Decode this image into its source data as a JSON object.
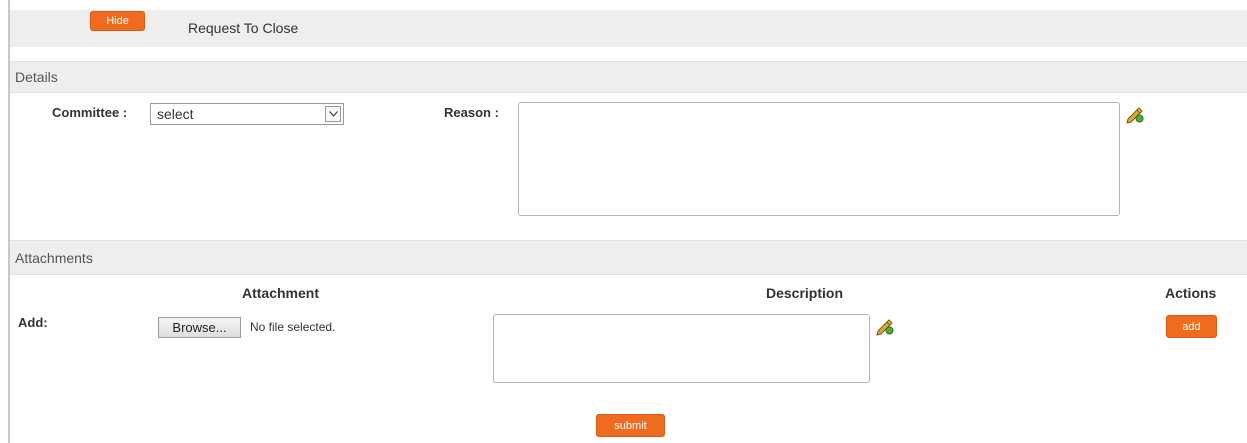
{
  "header": {
    "hide_label": "Hide",
    "title": "Request To Close"
  },
  "details": {
    "section_title": "Details",
    "committee_label": "Committee :",
    "committee_value": "select",
    "reason_label": "Reason :"
  },
  "attachments": {
    "section_title": "Attachments",
    "columns": [
      "Attachment",
      "Description",
      "Actions"
    ],
    "add_row_label": "Add:",
    "browse_label": "Browse...",
    "no_file_text": "No file selected.",
    "add_button_label": "add"
  },
  "footer": {
    "submit_label": "submit"
  },
  "colors": {
    "accent": "#ee6b1f",
    "section_bg": "#eeeeee"
  },
  "icons": {
    "edit": "pencil-edit-icon",
    "dropdown": "chevron-down-icon"
  }
}
